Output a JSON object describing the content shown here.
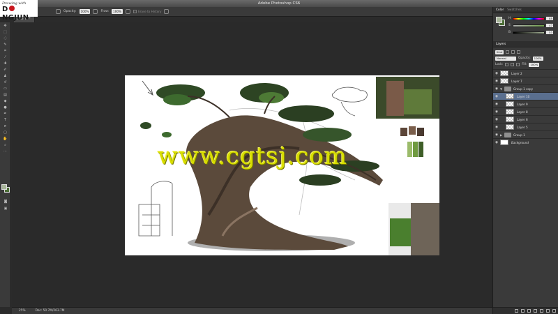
{
  "app": {
    "title": "Adobe Photoshop CS6"
  },
  "logo": {
    "line1": "Drawing with",
    "line2a": "D",
    "line2b": "NGJUN"
  },
  "options": {
    "opacity_label": "Opacity:",
    "opacity_value": "100%",
    "flow_label": "Flow:",
    "flow_value": "100%",
    "erase_history_label": "Erase to History"
  },
  "document": {
    "tab_label": "RGB/8) *"
  },
  "status": {
    "zoom": "25%",
    "doc_info": "Doc: 50.7M/263.7M"
  },
  "color_panel": {
    "tabs": [
      "Color",
      "Swatches"
    ],
    "sliders": [
      {
        "label": "H",
        "value": "85"
      },
      {
        "label": "S",
        "value": "47"
      },
      {
        "label": "B",
        "value": "53"
      }
    ],
    "foreground": "#a8b69a",
    "background": "#4c6e36"
  },
  "layers_panel": {
    "tab_label": "Layers",
    "filter_label": "Kind",
    "blend_mode": "Normal",
    "opacity_label": "Opacity:",
    "opacity_value": "100%",
    "lock_label": "Lock:",
    "fill_label": "Fill:",
    "fill_value": "100%",
    "layers": [
      {
        "name": "Layer 2",
        "kind": "layer",
        "selected": false,
        "indent": false
      },
      {
        "name": "Layer 7",
        "kind": "layer",
        "selected": false,
        "indent": false
      },
      {
        "name": "Group 1 copy",
        "kind": "group",
        "selected": false,
        "indent": false,
        "expanded": true
      },
      {
        "name": "Layer 10",
        "kind": "layer",
        "selected": true,
        "indent": true
      },
      {
        "name": "Layer 9",
        "kind": "layer",
        "selected": false,
        "indent": true
      },
      {
        "name": "Layer 8",
        "kind": "layer",
        "selected": false,
        "indent": true
      },
      {
        "name": "Layer 6",
        "kind": "layer",
        "selected": false,
        "indent": true
      },
      {
        "name": "Layer 5",
        "kind": "layer",
        "selected": false,
        "indent": true
      },
      {
        "name": "Group 1",
        "kind": "group",
        "selected": false,
        "indent": false,
        "expanded": false
      },
      {
        "name": "Background",
        "kind": "background",
        "selected": false,
        "indent": false
      }
    ]
  },
  "watermark": {
    "text": "www.cgtsj.com"
  }
}
